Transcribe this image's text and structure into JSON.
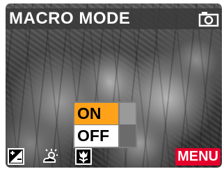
{
  "header": {
    "title": "MACRO MODE",
    "mode_icon": "camera-icon"
  },
  "macro_menu": {
    "options": [
      {
        "label": "ON",
        "selected": true
      },
      {
        "label": "OFF",
        "selected": false
      }
    ],
    "selected_color": "#ffa21a"
  },
  "bottom_bar": {
    "icons": [
      "exposure-compensation-icon",
      "white-balance-icon",
      "macro-flower-icon"
    ],
    "menu_label": "MENU",
    "menu_color": "#e4002a"
  }
}
